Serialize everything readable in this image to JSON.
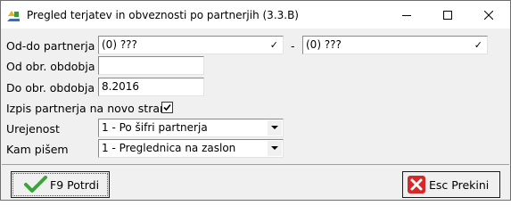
{
  "window": {
    "title": "Pregled terjatev in obveznosti po partnerjih  (3.3.B)"
  },
  "form": {
    "partner_range": {
      "label": "Od-do partnerja",
      "from_value": "(0) ???",
      "to_value": "(0) ???",
      "separator": "-"
    },
    "from_period": {
      "label": "Od obr. obdobja",
      "value": ""
    },
    "to_period": {
      "label": "Do obr. obdobja",
      "value": "8.2016"
    },
    "new_page": {
      "label": "Izpis partnerja na novo stran",
      "checked": true
    },
    "sort": {
      "label": "Urejenost",
      "value": "1 - Po šifri partnerja"
    },
    "output": {
      "label": "Kam pišem",
      "value": "1 - Preglednica na zaslon"
    }
  },
  "buttons": {
    "confirm_label": "F9 Potrdi",
    "cancel_label": "Esc Prekini"
  },
  "icons": {
    "app": "app-icon",
    "minimize": "minimize-icon",
    "maximize": "maximize-icon",
    "close": "close-icon",
    "confirm": "green-checkmark-icon",
    "cancel": "red-x-icon"
  },
  "colors": {
    "confirm_icon": "#3aa63a",
    "cancel_icon": "#d62828"
  }
}
